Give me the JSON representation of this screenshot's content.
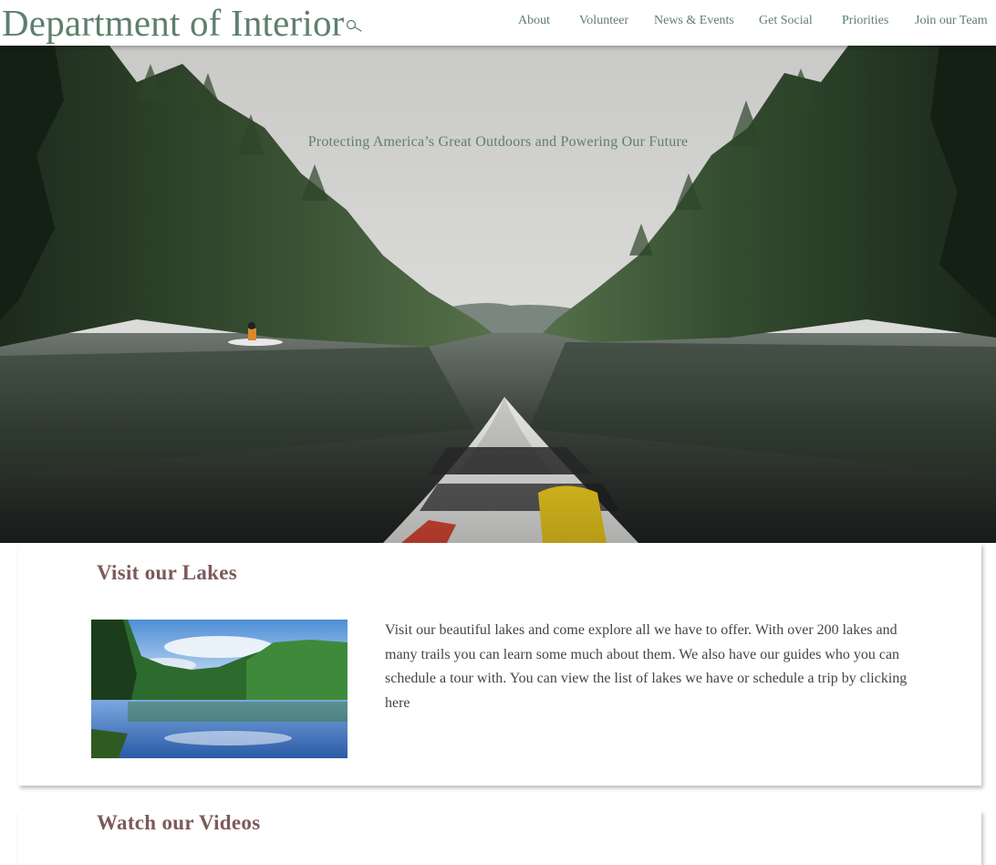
{
  "header": {
    "site_title": "Department of Interior",
    "nav": [
      "About",
      "Volunteer",
      "News & Events",
      "Get Social",
      "Priorities",
      "Join our Team"
    ]
  },
  "hero": {
    "tagline": "Protecting America’s Great Outdoors and Powering Our Future"
  },
  "sections": {
    "lakes": {
      "heading": "Visit our Lakes",
      "body": "Visit our beautiful lakes and come explore all we have to offer. With over 200 lakes and many trails you can learn some much about them. We also have our guides who you can schedule a tour with. You can view the list of lakes we have or schedule a trip by clicking",
      "link": "here"
    },
    "videos": {
      "heading": "Watch our Videos"
    }
  },
  "colors": {
    "title_green": "#5e7f6e",
    "heading_mauve": "#7d5a5a",
    "body_text": "#444444"
  },
  "icons": {
    "search": "search-icon"
  }
}
